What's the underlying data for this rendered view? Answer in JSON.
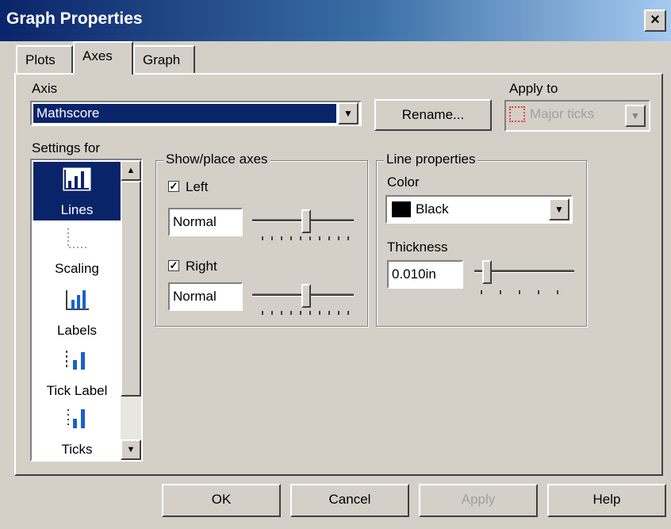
{
  "window": {
    "title": "Graph Properties",
    "close_label": "×"
  },
  "tabs": [
    {
      "label": "Plots"
    },
    {
      "label": "Axes"
    },
    {
      "label": "Graph"
    }
  ],
  "axis": {
    "label": "Axis",
    "value": "Mathscore",
    "rename_label": "Rename..."
  },
  "apply_to": {
    "label": "Apply to",
    "value": "Major ticks"
  },
  "settings_for": {
    "label": "Settings for",
    "items": [
      {
        "label": "Lines"
      },
      {
        "label": "Scaling"
      },
      {
        "label": "Labels"
      },
      {
        "label": "Tick Label"
      },
      {
        "label": "Ticks"
      }
    ],
    "selected": "Lines"
  },
  "show_place_axes": {
    "legend": "Show/place axes",
    "left": {
      "label": "Left",
      "checked": true,
      "position": "Normal"
    },
    "right": {
      "label": "Right",
      "checked": true,
      "position": "Normal"
    }
  },
  "line_properties": {
    "legend": "Line properties",
    "color_label": "Color",
    "color_value": "Black",
    "color_swatch": "#000000",
    "thickness_label": "Thickness",
    "thickness_value": "0.010in"
  },
  "buttons": {
    "ok": "OK",
    "cancel": "Cancel",
    "apply": "Apply",
    "help": "Help"
  },
  "colors": {
    "selection": "#0a246a",
    "face": "#d4d0c8",
    "disabled_text": "#a0a0a0",
    "apply_to_icon": "#e04040"
  }
}
